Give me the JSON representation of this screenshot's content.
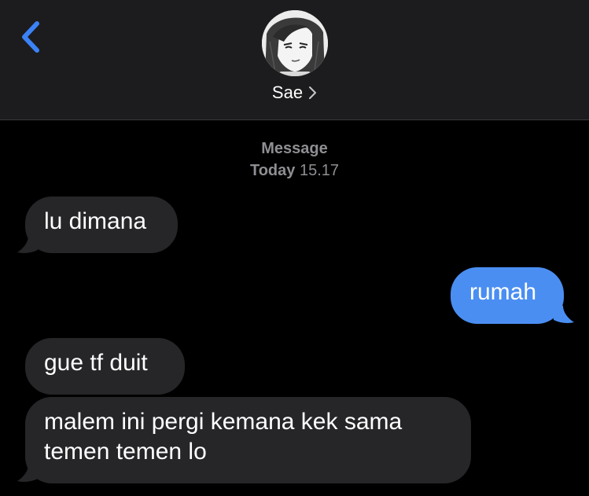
{
  "header": {
    "contact_name": "Sae",
    "back_icon": "chevron-left-icon",
    "contact_chevron_icon": "chevron-right-icon",
    "avatar": "contact-avatar"
  },
  "meta": {
    "service": "Message",
    "day": "Today",
    "time": "15.17"
  },
  "messages": [
    {
      "direction": "incoming",
      "text": "lu dimana"
    },
    {
      "direction": "outgoing",
      "text": "rumah"
    },
    {
      "direction": "incoming",
      "text": "gue tf duit"
    },
    {
      "direction": "incoming",
      "lines": [
        "malem ini pergi kemana kek sama",
        "temen temen lo"
      ]
    }
  ],
  "colors": {
    "background": "#000000",
    "header": "#1c1c1e",
    "incoming_bubble": "#262629",
    "outgoing_bubble": "#4a8ef2",
    "accent": "#3b82f6",
    "meta_text": "#8e8e93"
  }
}
